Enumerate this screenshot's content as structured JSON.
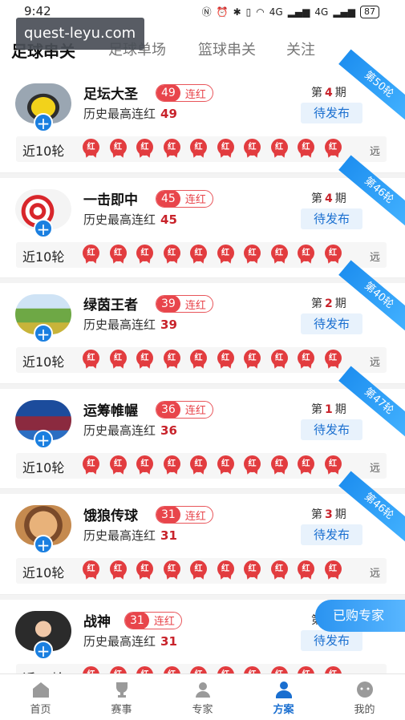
{
  "status_bar": {
    "time": "9:42",
    "signal1": "4G",
    "signal2": "4G",
    "battery": "87"
  },
  "watermark": "quest-leyu.com",
  "top_tabs": [
    {
      "label": "足球串关",
      "active": true
    },
    {
      "label": "足球单场",
      "active": false
    },
    {
      "label": "篮球串关",
      "active": false
    },
    {
      "label": "关注",
      "active": false
    }
  ],
  "labels": {
    "history_prefix": "历史最高连红",
    "streak_label": "连红",
    "recent_label": "近10轮",
    "publish": "待发布",
    "far": "远",
    "badge": "红",
    "period_prefix": "第",
    "period_suffix": "期"
  },
  "experts": [
    {
      "name": "足坛大圣",
      "streak": "49",
      "history": "49",
      "period": "4",
      "round": "第50轮"
    },
    {
      "name": "一击即中",
      "streak": "45",
      "history": "45",
      "period": "4",
      "round": "第46轮"
    },
    {
      "name": "绿茵王者",
      "streak": "39",
      "history": "39",
      "period": "2",
      "round": "第40轮"
    },
    {
      "name": "运筹帷幄",
      "streak": "36",
      "history": "36",
      "period": "1",
      "round": "第47轮"
    },
    {
      "name": "饿狼传球",
      "streak": "31",
      "history": "31",
      "period": "3",
      "round": "第46轮"
    },
    {
      "name": "战神",
      "streak": "31",
      "history": "31",
      "period": "",
      "round": ""
    }
  ],
  "floating_button": "已购专家",
  "bottom_nav": [
    {
      "label": "首页",
      "icon": "home-icon",
      "active": false
    },
    {
      "label": "赛事",
      "icon": "trophy-icon",
      "active": false
    },
    {
      "label": "专家",
      "icon": "expert-icon",
      "active": false
    },
    {
      "label": "方案",
      "icon": "plan-icon",
      "active": true
    },
    {
      "label": "我的",
      "icon": "profile-icon",
      "active": false
    }
  ],
  "colors": {
    "accent_blue": "#1a6fd0",
    "red": "#e23c3f"
  }
}
